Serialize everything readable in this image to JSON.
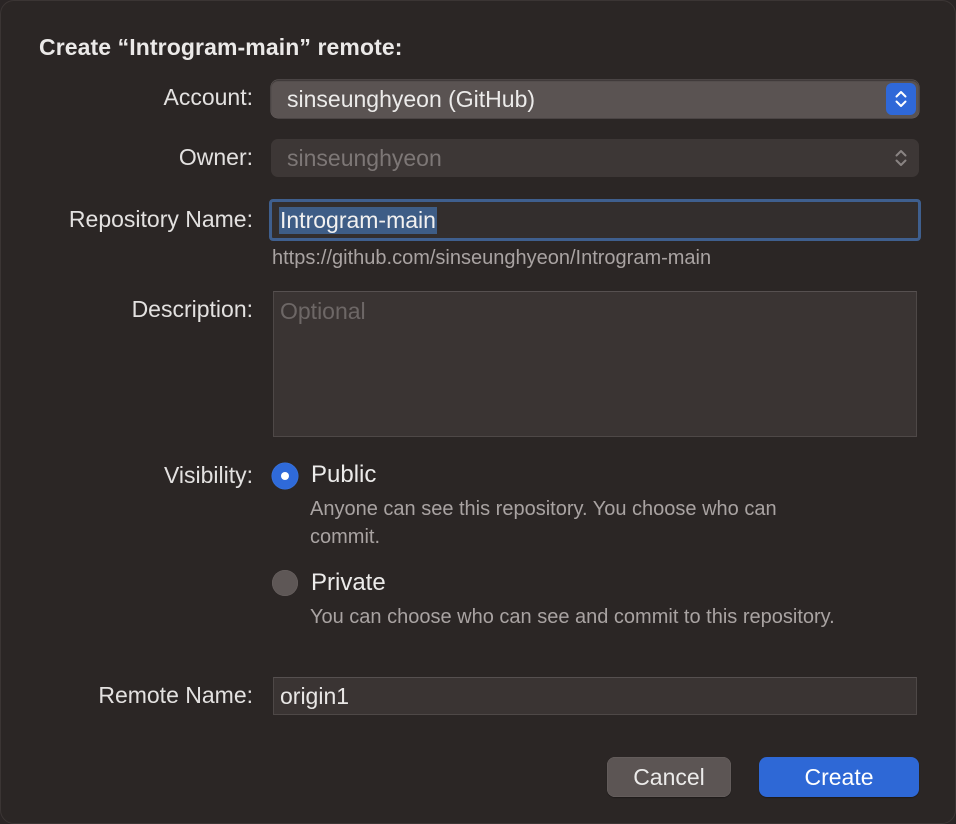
{
  "dialog": {
    "title": "Create “Introgram-main” remote:"
  },
  "account": {
    "label": "Account:",
    "value": "sinseunghyeon (GitHub)"
  },
  "owner": {
    "label": "Owner:",
    "value": "sinseunghyeon"
  },
  "repository": {
    "label": "Repository Name:",
    "value": "Introgram-main",
    "url": "https://github.com/sinseunghyeon/Introgram-main"
  },
  "description": {
    "label": "Description:",
    "placeholder": "Optional",
    "value": ""
  },
  "visibility": {
    "label": "Visibility:",
    "options": [
      {
        "label": "Public",
        "description": "Anyone can see this repository. You choose who can commit.",
        "selected": true
      },
      {
        "label": "Private",
        "description": "You can choose who can see and commit to this repository.",
        "selected": false
      }
    ]
  },
  "remote": {
    "label": "Remote Name:",
    "value": "origin1"
  },
  "buttons": {
    "cancel": "Cancel",
    "create": "Create"
  },
  "colors": {
    "accent": "#2f68d8",
    "background": "#2b2625",
    "focus_ring": "#3f5f8e"
  }
}
